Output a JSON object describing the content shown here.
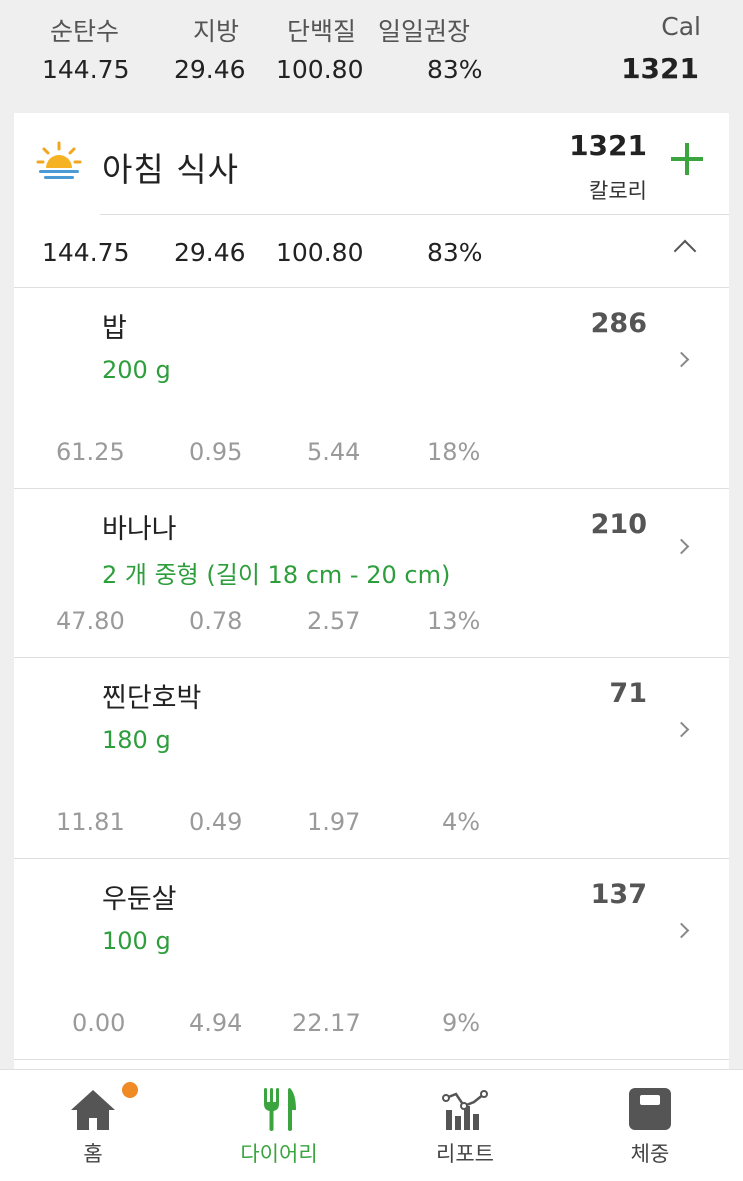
{
  "summary": {
    "headers": [
      "순탄수",
      "지방",
      "단백질",
      "일일권장"
    ],
    "values": [
      "144.75",
      "29.46",
      "100.80",
      "83%"
    ],
    "cal_label": "Cal",
    "cal_value": "1321"
  },
  "meal": {
    "icon": "sunrise-icon",
    "title": "아침 식사",
    "calories": "1321",
    "calories_unit": "칼로리",
    "totals": [
      "144.75",
      "29.46",
      "100.80",
      "83%"
    ],
    "add_icon": "plus-icon",
    "collapse_icon": "chevron-up-icon"
  },
  "foods": [
    {
      "name": "밥",
      "amount": "200 g",
      "calories": "286",
      "nutrients": [
        "61.25",
        "0.95",
        "5.44",
        "18%"
      ]
    },
    {
      "name": "바나나",
      "amount": "2 개 중형 (길이 18 cm - 20 cm)",
      "calories": "210",
      "nutrients": [
        "47.80",
        "0.78",
        "2.57",
        "13%"
      ]
    },
    {
      "name": "찐단호박",
      "amount": "180 g",
      "calories": "71",
      "nutrients": [
        "11.81",
        "0.49",
        "1.97",
        "4%"
      ]
    },
    {
      "name": "우둔살",
      "amount": "100 g",
      "calories": "137",
      "nutrients": [
        "0.00",
        "4.94",
        "22.17",
        "9%"
      ]
    }
  ],
  "nav": [
    {
      "label": "홈",
      "icon": "home-icon",
      "active": false,
      "badge": true
    },
    {
      "label": "다이어리",
      "icon": "fork-knife-icon",
      "active": true,
      "badge": false
    },
    {
      "label": "리포트",
      "icon": "chart-icon",
      "active": false,
      "badge": false
    },
    {
      "label": "체중",
      "icon": "scale-icon",
      "active": false,
      "badge": false
    }
  ],
  "colors": {
    "accent": "#3aa53f",
    "amount_text": "#2e9e3c",
    "badge": "#f08a24",
    "background": "#efefef"
  }
}
